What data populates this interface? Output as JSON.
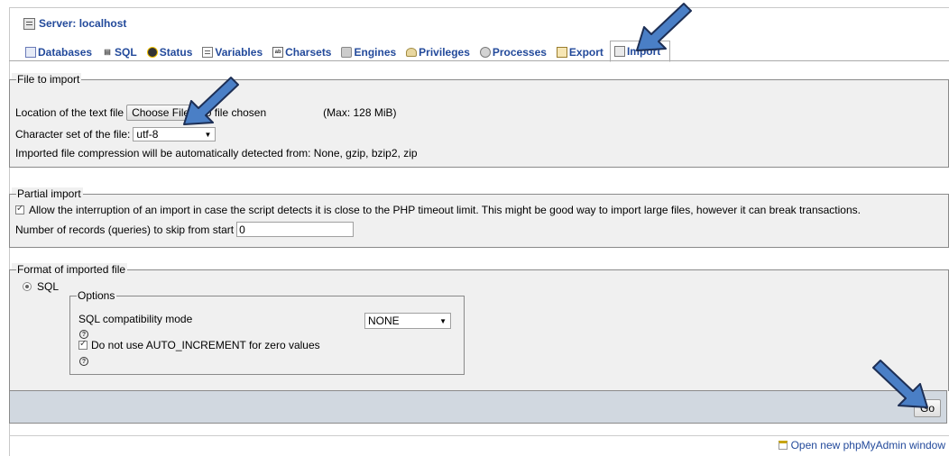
{
  "header": {
    "server_label": "Server: localhost"
  },
  "tabs": [
    {
      "label": "Databases",
      "icon": "databases-icon"
    },
    {
      "label": "SQL",
      "icon": "sql-icon"
    },
    {
      "label": "Status",
      "icon": "status-icon"
    },
    {
      "label": "Variables",
      "icon": "variables-icon"
    },
    {
      "label": "Charsets",
      "icon": "charsets-icon"
    },
    {
      "label": "Engines",
      "icon": "engines-icon"
    },
    {
      "label": "Privileges",
      "icon": "privileges-icon"
    },
    {
      "label": "Processes",
      "icon": "processes-icon"
    },
    {
      "label": "Export",
      "icon": "export-icon"
    },
    {
      "label": "Import",
      "icon": "import-icon",
      "active": true
    }
  ],
  "file_to_import": {
    "legend": "File to import",
    "location_label": "Location of the text file",
    "choose_button": "Choose File",
    "no_file_text": "No file chosen",
    "max_size": "(Max: 128 MiB)",
    "charset_label": "Character set of the file:",
    "charset_value": "utf-8",
    "compression_note": "Imported file compression will be automatically detected from: None, gzip, bzip2, zip"
  },
  "partial_import": {
    "legend": "Partial import",
    "allow_interrupt_label": "Allow the interruption of an import in case the script detects it is close to the PHP timeout limit. This might be good way to import large files, however it can break transactions.",
    "allow_interrupt_checked": true,
    "skip_label": "Number of records (queries) to skip from start",
    "skip_value": "0"
  },
  "format": {
    "legend": "Format of imported file",
    "sql_radio_label": "SQL",
    "sql_selected": true,
    "options_legend": "Options",
    "compat_label": "SQL compatibility mode",
    "compat_value": "NONE",
    "auto_increment_label": "Do not use AUTO_INCREMENT for zero values",
    "auto_increment_checked": true
  },
  "actions": {
    "go_label": "Go"
  },
  "footer": {
    "new_window_link": "Open new phpMyAdmin window"
  },
  "colors": {
    "link": "#234a9b",
    "panel": "#f0f0f0",
    "go_bar": "#d1d8e0",
    "arrow": "#4a7fc6"
  },
  "icons": {
    "help": "help-icon",
    "arrow": "pointer-arrow"
  }
}
